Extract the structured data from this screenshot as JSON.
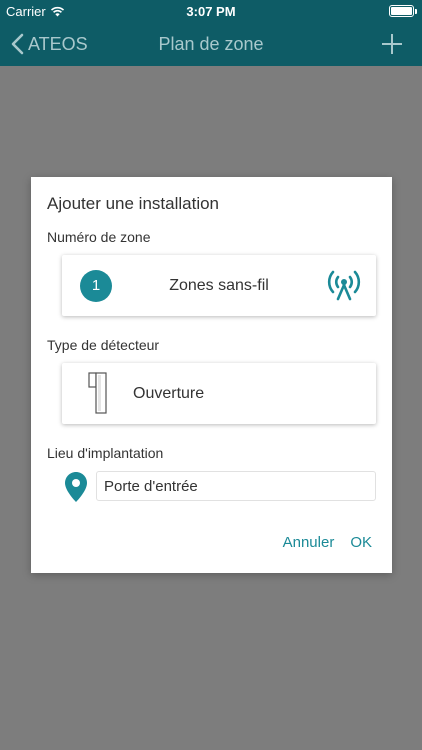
{
  "status_bar": {
    "carrier": "Carrier",
    "time": "3:07 PM",
    "icons": [
      "wifi-icon",
      "battery-icon"
    ]
  },
  "nav": {
    "back_label": "ATEOS",
    "title": "Plan de zone",
    "add_icon": "plus-icon"
  },
  "dialog": {
    "title": "Ajouter une installation",
    "zone": {
      "label": "Numéro de zone",
      "number": "1",
      "name": "Zones sans-fil",
      "icon": "wireless-signal-icon"
    },
    "detector": {
      "label": "Type de détecteur",
      "name": "Ouverture",
      "icon": "door-sensor-icon"
    },
    "location": {
      "label": "Lieu d'implantation",
      "value": "Porte d'entrée",
      "icon": "location-pin-icon"
    },
    "cancel_label": "Annuler",
    "ok_label": "OK"
  },
  "colors": {
    "header": "#0e5c66",
    "accent": "#1b8a97",
    "overlay": "#7d7d7d",
    "header_text": "#a8c8cc"
  }
}
